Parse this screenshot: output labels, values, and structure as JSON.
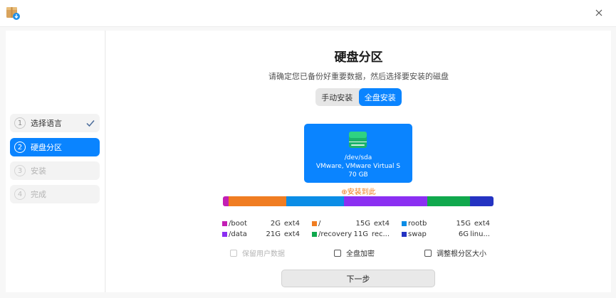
{
  "window": {
    "app_icon": "installer-package-icon",
    "close_icon": "close-icon"
  },
  "sidebar": {
    "steps": [
      {
        "num": "1",
        "label": "选择语言",
        "state": "done"
      },
      {
        "num": "2",
        "label": "硬盘分区",
        "state": "active"
      },
      {
        "num": "3",
        "label": "安装",
        "state": "pending"
      },
      {
        "num": "4",
        "label": "完成",
        "state": "pending"
      }
    ]
  },
  "main": {
    "title": "硬盘分区",
    "subtitle": "请确定您已备份好重要数据，然后选择要安装的磁盘",
    "mode_tabs": [
      {
        "label": "手动安装",
        "selected": false
      },
      {
        "label": "全盘安装",
        "selected": true
      }
    ],
    "disk": {
      "icon": "drive-icon",
      "device": "/dev/sda",
      "model": "VMware, VMware Virtual S",
      "size": "70 GB",
      "install_hint": "⊕安装到此"
    },
    "partitions": [
      {
        "name": "/boot",
        "size": "2G",
        "fs": "ext4",
        "color": "#c31fb4"
      },
      {
        "name": "/",
        "size": "15G",
        "fs": "ext4",
        "color": "#f07d22"
      },
      {
        "name": "rootb",
        "size": "15G",
        "fs": "ext4",
        "color": "#0b8de6"
      },
      {
        "name": "/data",
        "size": "21G",
        "fs": "ext4",
        "color": "#8b2ff2"
      },
      {
        "name": "/recovery",
        "size": "11G",
        "fs": "rec...",
        "color": "#10a84d"
      },
      {
        "name": "swap",
        "size": "6G",
        "fs": "linu...",
        "color": "#2433c2"
      }
    ],
    "options": [
      {
        "label": "保留用户数据",
        "checked": false,
        "enabled": false
      },
      {
        "label": "全盘加密",
        "checked": false,
        "enabled": true
      },
      {
        "label": "调整根分区大小",
        "checked": false,
        "enabled": true
      }
    ],
    "next_button": "下一步"
  }
}
